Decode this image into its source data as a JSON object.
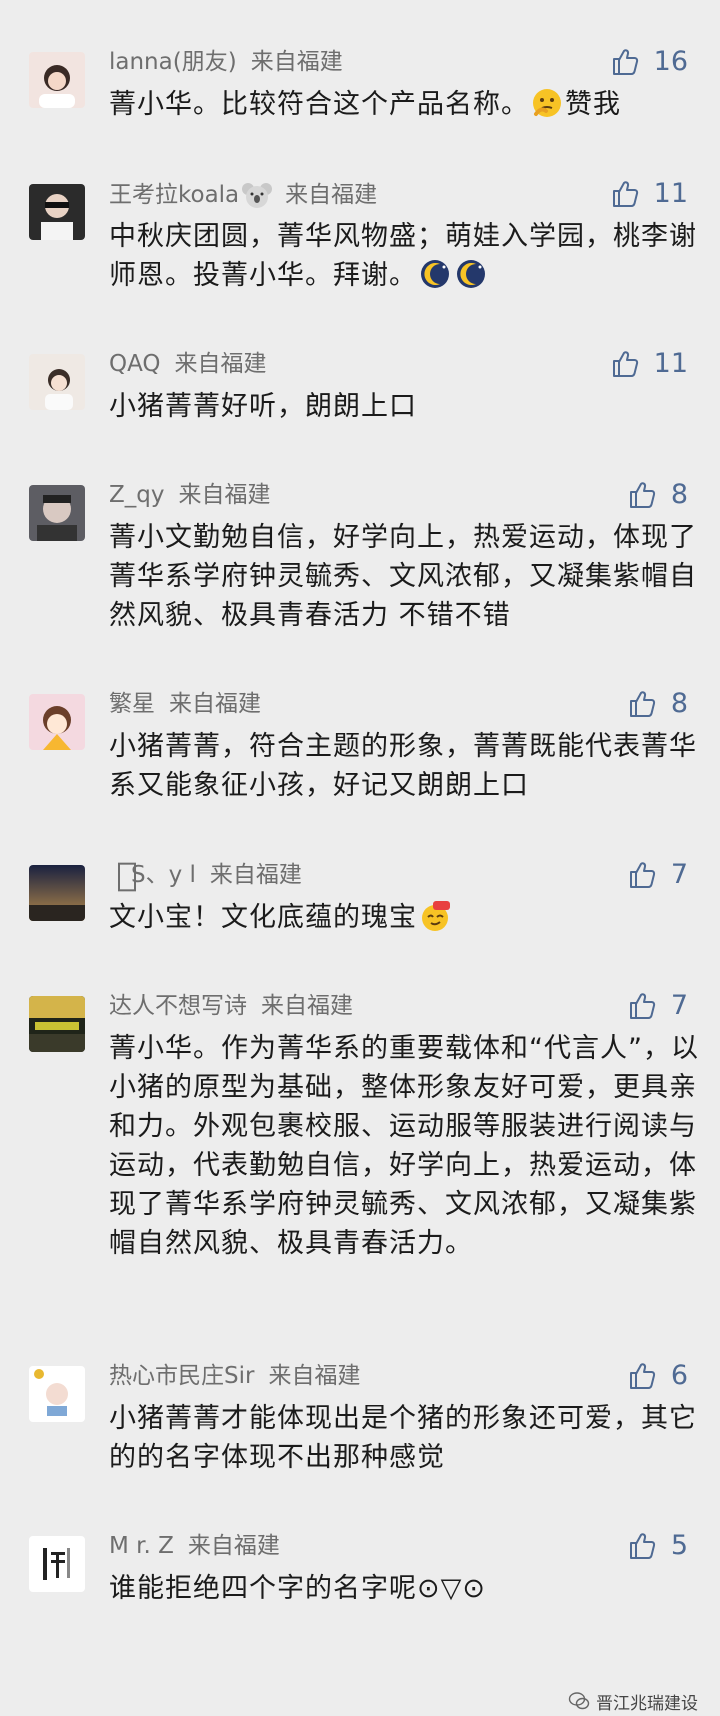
{
  "comments": [
    {
      "name": "lanna(朋友)",
      "from": "来自福建",
      "likes": "16",
      "text_a": "菁小华。比较符合这个产品名称。",
      "text_b": "赞我",
      "emoji": "thinking-face-emoji"
    },
    {
      "name": "王考拉koala",
      "from": "来自福建",
      "likes": "11",
      "text_a": "中秋庆团圆，菁华风物盛；萌娃入学园，桃李谢师恩。投菁小华。拜谢。",
      "emoji": "sleeping-moon-emoji"
    },
    {
      "name": "QAQ",
      "from": "来自福建",
      "likes": "11",
      "text_a": "小猪菁菁好听，朗朗上口"
    },
    {
      "name": "Z_qy",
      "from": "来自福建",
      "likes": "8",
      "text_a": "菁小文勤勉自信，好学向上，热爱运动，体现了菁华系学府钟灵毓秀、文风浓郁，又凝集紫帽自然风貌、极具青春活力 不错不错"
    },
    {
      "name": "繁星",
      "from": "来自福建",
      "likes": "8",
      "text_a": "小猪菁菁，符合主题的形象，菁菁既能代表菁华系又能象征小孩，好记又朗朗上口"
    },
    {
      "name": "S、y l",
      "from": "来自福建",
      "likes": "7",
      "text_a": "文小宝！文化底蕴的瑰宝",
      "emoji": "666-face-emoji"
    },
    {
      "name": "达人不想写诗",
      "from": "来自福建",
      "likes": "7",
      "text_a": "菁小华。作为菁华系的重要载体和“代言人”，以小猪的原型为基础，整体形象友好可爱，更具亲和力。外观包裹校服、运动服等服装进行阅读与运动，代表勤勉自信，好学向上，热爱运动，体现了菁华系学府钟灵毓秀、文风浓郁，又凝集紫帽自然风貌、极具青春活力。"
    },
    {
      "name": "热心市民庄Sir",
      "from": "来自福建",
      "likes": "6",
      "text_a": "小猪菁菁才能体现出是个猪的形象还可爱，其它的的名字体现不出那种感觉"
    },
    {
      "name": "M r. Z",
      "from": "来自福建",
      "likes": "5",
      "text_a": "谁能拒绝四个字的名字呢⊙▽⊙"
    }
  ],
  "watermark": "晋江兆瑞建设",
  "colors": {
    "background": "#ededed",
    "name": "#6e6e6e",
    "like": "#4f6a93",
    "text": "#1b1b1b"
  }
}
